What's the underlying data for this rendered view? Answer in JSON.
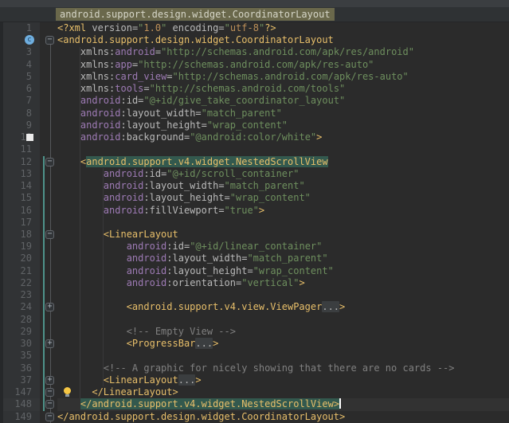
{
  "breadcrumb": {
    "label": "android.support.design.widget.CoordinatorLayout"
  },
  "theme": {
    "editor_bg": "#2B2B2B",
    "gutter_bg": "#313335",
    "line_number": "#606366",
    "tag": "#E8BF6A",
    "namespace": "#9E7BB5",
    "attribute": "#BABABA",
    "string": "#6E8F5E",
    "prolog_value": "#BC8F58",
    "comment": "#808080",
    "tag_highlight_bg": "#33594E",
    "breadcrumb_bg": "#6A684B",
    "breadcrumb_text": "#D6D6C8",
    "scope_line": "#4E938A",
    "caret_line_bg": "#323232"
  },
  "editor": {
    "folded_placeholder": "...",
    "rows": [
      {
        "n": "1",
        "icon": null,
        "fold": null,
        "caretLine": false,
        "tokens": [
          [
            "tag",
            "<?xml "
          ],
          [
            "attr",
            "version"
          ],
          [
            "punc",
            "="
          ],
          [
            "str",
            "\""
          ],
          [
            "val",
            "1.0"
          ],
          [
            "str",
            "\""
          ],
          [
            "attr",
            " encoding"
          ],
          [
            "punc",
            "="
          ],
          [
            "str",
            "\""
          ],
          [
            "val",
            "utf-8"
          ],
          [
            "str",
            "\""
          ],
          [
            "tag",
            "?>"
          ]
        ]
      },
      {
        "n": "2",
        "icon": "class-c",
        "fold": "start",
        "caretLine": false,
        "tokens": [
          [
            "tag",
            "<android.support.design.widget.CoordinatorLayout"
          ]
        ]
      },
      {
        "n": "3",
        "icon": null,
        "fold": null,
        "caretLine": false,
        "tokens": [
          [
            "attr",
            "    xmlns"
          ],
          [
            "punc",
            ":"
          ],
          [
            "ns",
            "android"
          ],
          [
            "punc",
            "="
          ],
          [
            "str",
            "\"http://schemas.android.com/apk/res/android\""
          ]
        ]
      },
      {
        "n": "4",
        "icon": null,
        "fold": null,
        "caretLine": false,
        "tokens": [
          [
            "attr",
            "    xmlns"
          ],
          [
            "punc",
            ":"
          ],
          [
            "ns",
            "app"
          ],
          [
            "punc",
            "="
          ],
          [
            "str",
            "\"http://schemas.android.com/apk/res-auto\""
          ]
        ]
      },
      {
        "n": "5",
        "icon": null,
        "fold": null,
        "caretLine": false,
        "tokens": [
          [
            "attr",
            "    xmlns"
          ],
          [
            "punc",
            ":"
          ],
          [
            "ns",
            "card_view"
          ],
          [
            "punc",
            "="
          ],
          [
            "str",
            "\"http://schemas.android.com/apk/res-auto\""
          ]
        ]
      },
      {
        "n": "6",
        "icon": null,
        "fold": null,
        "caretLine": false,
        "tokens": [
          [
            "attr",
            "    xmlns"
          ],
          [
            "punc",
            ":"
          ],
          [
            "ns",
            "tools"
          ],
          [
            "punc",
            "="
          ],
          [
            "str",
            "\"http://schemas.android.com/tools\""
          ]
        ]
      },
      {
        "n": "7",
        "icon": null,
        "fold": null,
        "caretLine": false,
        "tokens": [
          [
            "ns",
            "    android"
          ],
          [
            "punc",
            ":"
          ],
          [
            "attr",
            "id"
          ],
          [
            "punc",
            "="
          ],
          [
            "str",
            "\"@+id/give_take_coordinator_layout\""
          ]
        ]
      },
      {
        "n": "8",
        "icon": null,
        "fold": null,
        "caretLine": false,
        "tokens": [
          [
            "ns",
            "    android"
          ],
          [
            "punc",
            ":"
          ],
          [
            "attr",
            "layout_width"
          ],
          [
            "punc",
            "="
          ],
          [
            "str",
            "\"match_parent\""
          ]
        ]
      },
      {
        "n": "9",
        "icon": null,
        "fold": null,
        "caretLine": false,
        "tokens": [
          [
            "ns",
            "    android"
          ],
          [
            "punc",
            ":"
          ],
          [
            "attr",
            "layout_height"
          ],
          [
            "punc",
            "="
          ],
          [
            "str",
            "\"wrap_content\""
          ]
        ]
      },
      {
        "n": "10",
        "icon": "bookmark",
        "fold": null,
        "caretLine": false,
        "tokens": [
          [
            "ns",
            "    android"
          ],
          [
            "punc",
            ":"
          ],
          [
            "attr",
            "background"
          ],
          [
            "punc",
            "="
          ],
          [
            "str",
            "\"@android:color/white\""
          ],
          [
            "tag",
            ">"
          ]
        ]
      },
      {
        "n": "11",
        "icon": null,
        "fold": null,
        "caretLine": false,
        "tokens": []
      },
      {
        "n": "12",
        "icon": null,
        "fold": "start",
        "caretLine": false,
        "tokens": [
          [
            "tag",
            "    <"
          ],
          [
            "hl",
            "android.support.v4.widget.NestedScrollView"
          ]
        ]
      },
      {
        "n": "13",
        "icon": null,
        "fold": null,
        "caretLine": false,
        "tokens": [
          [
            "ns",
            "        android"
          ],
          [
            "punc",
            ":"
          ],
          [
            "attr",
            "id"
          ],
          [
            "punc",
            "="
          ],
          [
            "str",
            "\"@+id/scroll_container\""
          ]
        ]
      },
      {
        "n": "14",
        "icon": null,
        "fold": null,
        "caretLine": false,
        "tokens": [
          [
            "ns",
            "        android"
          ],
          [
            "punc",
            ":"
          ],
          [
            "attr",
            "layout_width"
          ],
          [
            "punc",
            "="
          ],
          [
            "str",
            "\"match_parent\""
          ]
        ]
      },
      {
        "n": "15",
        "icon": null,
        "fold": null,
        "caretLine": false,
        "tokens": [
          [
            "ns",
            "        android"
          ],
          [
            "punc",
            ":"
          ],
          [
            "attr",
            "layout_height"
          ],
          [
            "punc",
            "="
          ],
          [
            "str",
            "\"wrap_content\""
          ]
        ]
      },
      {
        "n": "16",
        "icon": null,
        "fold": null,
        "caretLine": false,
        "tokens": [
          [
            "ns",
            "        android"
          ],
          [
            "punc",
            ":"
          ],
          [
            "attr",
            "fillViewport"
          ],
          [
            "punc",
            "="
          ],
          [
            "str",
            "\"true\""
          ],
          [
            "tag",
            ">"
          ]
        ]
      },
      {
        "n": "17",
        "icon": null,
        "fold": null,
        "caretLine": false,
        "tokens": []
      },
      {
        "n": "18",
        "icon": null,
        "fold": "start",
        "caretLine": false,
        "tokens": [
          [
            "tag",
            "        <LinearLayout"
          ]
        ]
      },
      {
        "n": "19",
        "icon": null,
        "fold": null,
        "caretLine": false,
        "tokens": [
          [
            "ns",
            "            android"
          ],
          [
            "punc",
            ":"
          ],
          [
            "attr",
            "id"
          ],
          [
            "punc",
            "="
          ],
          [
            "str",
            "\"@+id/linear_container\""
          ]
        ]
      },
      {
        "n": "20",
        "icon": null,
        "fold": null,
        "caretLine": false,
        "tokens": [
          [
            "ns",
            "            android"
          ],
          [
            "punc",
            ":"
          ],
          [
            "attr",
            "layout_width"
          ],
          [
            "punc",
            "="
          ],
          [
            "str",
            "\"match_parent\""
          ]
        ]
      },
      {
        "n": "21",
        "icon": null,
        "fold": null,
        "caretLine": false,
        "tokens": [
          [
            "ns",
            "            android"
          ],
          [
            "punc",
            ":"
          ],
          [
            "attr",
            "layout_height"
          ],
          [
            "punc",
            "="
          ],
          [
            "str",
            "\"wrap_content\""
          ]
        ]
      },
      {
        "n": "22",
        "icon": null,
        "fold": null,
        "caretLine": false,
        "tokens": [
          [
            "ns",
            "            android"
          ],
          [
            "punc",
            ":"
          ],
          [
            "attr",
            "orientation"
          ],
          [
            "punc",
            "="
          ],
          [
            "str",
            "\"vertical\""
          ],
          [
            "tag",
            ">"
          ]
        ]
      },
      {
        "n": "23",
        "icon": null,
        "fold": null,
        "caretLine": false,
        "tokens": []
      },
      {
        "n": "24",
        "icon": null,
        "fold": "plus",
        "caretLine": false,
        "tokens": [
          [
            "tag",
            "            <android.support.v4.view.ViewPager"
          ],
          [
            "fold",
            "..."
          ],
          [
            "tag",
            ">"
          ]
        ]
      },
      {
        "n": "28",
        "icon": null,
        "fold": null,
        "caretLine": false,
        "tokens": []
      },
      {
        "n": "29",
        "icon": null,
        "fold": null,
        "caretLine": false,
        "tokens": [
          [
            "comment",
            "            <!-- Empty View -->"
          ]
        ]
      },
      {
        "n": "30",
        "icon": null,
        "fold": "plus",
        "caretLine": false,
        "tokens": [
          [
            "tag",
            "            <ProgressBar"
          ],
          [
            "fold",
            "..."
          ],
          [
            "tag",
            ">"
          ]
        ]
      },
      {
        "n": "35",
        "icon": null,
        "fold": null,
        "caretLine": false,
        "tokens": []
      },
      {
        "n": "36",
        "icon": null,
        "fold": null,
        "caretLine": false,
        "tokens": [
          [
            "comment",
            "        <!-- A graphic for nicely showing that there are no cards -->"
          ]
        ]
      },
      {
        "n": "37",
        "icon": null,
        "fold": "plus",
        "caretLine": false,
        "tokens": [
          [
            "tag",
            "        <LinearLayout"
          ],
          [
            "fold",
            "..."
          ],
          [
            "tag",
            ">"
          ]
        ]
      },
      {
        "n": "147",
        "icon": "bulb",
        "fold": "end",
        "caretLine": false,
        "tokens": [
          [
            "tag",
            "      </LinearLayout>"
          ]
        ]
      },
      {
        "n": "148",
        "icon": null,
        "fold": "end",
        "caretLine": true,
        "tokens": [
          [
            "tag",
            "    "
          ],
          [
            "hl",
            "</android.support.v4.widget.NestedScrollView>"
          ],
          [
            "caret",
            ""
          ]
        ]
      },
      {
        "n": "149",
        "icon": null,
        "fold": "end",
        "caretLine": false,
        "tokens": [
          [
            "tag",
            "</android.support.design.widget.CoordinatorLayout>"
          ]
        ]
      }
    ]
  }
}
